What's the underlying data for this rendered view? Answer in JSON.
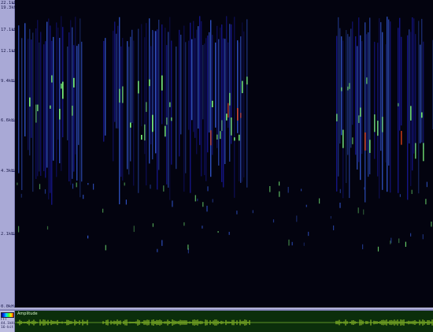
{
  "axis": {
    "frequency_labels": [
      "22.1kHz",
      "19.3kHz",
      "17.1kHz",
      "12.1kHz",
      "9.4kHz",
      "6.6kHz",
      "4.3kHz",
      "2.1kHz",
      "0.0kHz"
    ]
  },
  "waveform": {
    "title": "Amplitude"
  },
  "bottom_left": {
    "label_1": "FFT",
    "label_2": "44.1kHz",
    "label_3": "16-bit"
  },
  "colors": {
    "background": "#03030f",
    "low": "#1a1aa8",
    "mid": "#3f6bff",
    "high": "#7fff7f",
    "peak": "#ff4b1a",
    "waveform": "#c9ff33",
    "axis_panel": "#a9a9d6"
  }
}
